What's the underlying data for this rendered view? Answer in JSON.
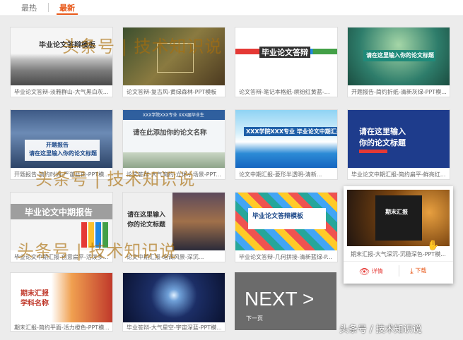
{
  "tabs": [
    "最热",
    "最新"
  ],
  "cards": [
    {
      "caption": "毕业论文答辩-淡雅群山-大气黑白灰..."
    },
    {
      "caption": "论文答辩-复古风-黄绿森林-PPT模板"
    },
    {
      "caption": "论文答辩-笔记本格纸-缤纷红黄蓝-开..."
    },
    {
      "caption": "开题报告-简约折纸-清新灰绿-PPT模..."
    },
    {
      "caption": "开题报告-简约时尚-严谨蓝白-PPT模..."
    },
    {
      "caption": "论文答辩-大气简约-立体小场景-PPT..."
    },
    {
      "caption": "论文中期汇报-菱形半透明-清新..."
    },
    {
      "caption": "毕业论文中期汇报-简约扁平-鲜亮红..."
    },
    {
      "caption": "毕业论文中期汇报-创意扁平-活泼多..."
    },
    {
      "caption": "论文中期汇报-暗调风景-深沉..."
    },
    {
      "caption": "毕业论文答辩-几何拼接-清新蓝绿-P..."
    },
    {
      "caption": "期末汇报-大气深沉-沉稳深色-PPT模..."
    },
    {
      "caption": "期末汇报-简约平面-活力橙色-PPT模..."
    },
    {
      "caption": "毕业答辩-大气星空-宇宙深蓝-PPT模..."
    }
  ],
  "thumbs": {
    "t1_title": "毕业论文答辩模板",
    "t3_title": "毕业论文答辩",
    "t4_title": "请在这里输入你的论文标题",
    "t5_line1": "开题报告",
    "t5_line2": "请在这里输入你的论文标题",
    "t6_header": "XXX学院XXX专业 XXX届毕业生",
    "t6_title": "请在此添加你的论文名称",
    "t7_title": "XXX学院XXX专业 毕业论文中期汇报",
    "t8_line1": "请在这里输入",
    "t8_line2": "你的论文标题",
    "t9_title": "毕业论文中期报告",
    "t10_line1": "请在这里输入",
    "t10_line2": "你的论文标题",
    "t11_title": "毕业论文答辩模板",
    "t12_title": "期末汇报",
    "t13_line1": "期末汇报",
    "t13_line2": "学科名称"
  },
  "hover": {
    "detail": "详情",
    "download": "下载"
  },
  "next": {
    "label": "NEXT >",
    "sub": "下一页"
  },
  "watermarks": [
    "头条号 | 技术知识说",
    "头条号 | 技术知识说",
    "头条号 | 技术知识说"
  ],
  "corner_watermark": "头条号 / 技术知识说"
}
